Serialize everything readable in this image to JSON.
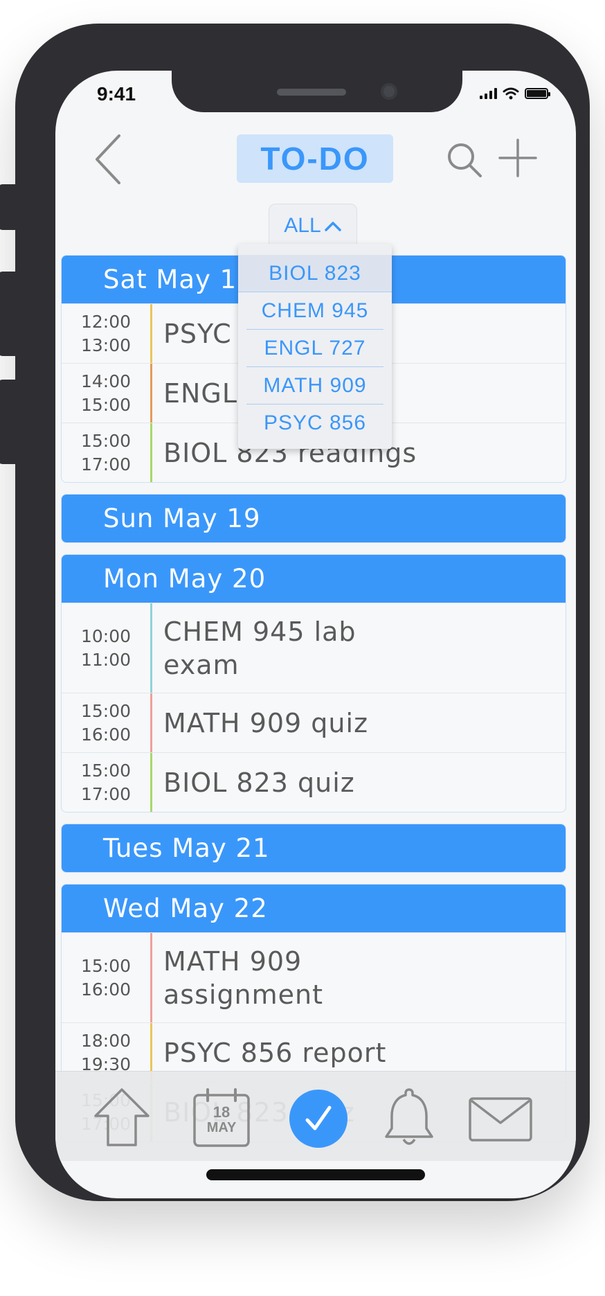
{
  "status_bar": {
    "time": "9:41"
  },
  "header": {
    "title": "TO-DO"
  },
  "filter": {
    "label": "ALL"
  },
  "dropdown_options": [
    "BIOL 823",
    "CHEM 945",
    "ENGL 727",
    "MATH 909",
    "PSYC 856"
  ],
  "days": [
    {
      "label": "Sat May 18",
      "tasks": [
        {
          "start": "12:00",
          "end": "13:00",
          "title": "PSYC 856 quiz",
          "color": "#e9c65a"
        },
        {
          "start": "14:00",
          "end": "15:00",
          "title": "ENGL 727 essay",
          "color": "#e49a5c"
        },
        {
          "start": "15:00",
          "end": "17:00",
          "title": "BIOL 823 readings",
          "color": "#a7d86c"
        }
      ]
    },
    {
      "label": "Sun May 19",
      "tasks": []
    },
    {
      "label": "Mon May 20",
      "tasks": [
        {
          "start": "10:00",
          "end": "11:00",
          "title": "CHEM 945 lab exam",
          "color": "#8fd3d8"
        },
        {
          "start": "15:00",
          "end": "16:00",
          "title": "MATH 909 quiz",
          "color": "#ef9f9a"
        },
        {
          "start": "15:00",
          "end": "17:00",
          "title": "BIOL 823 quiz",
          "color": "#a7d86c"
        }
      ]
    },
    {
      "label": "Tues May 21",
      "tasks": []
    },
    {
      "label": "Wed May 22",
      "tasks": [
        {
          "start": "15:00",
          "end": "16:00",
          "title": "MATH 909 assignment",
          "color": "#ef9f9a"
        },
        {
          "start": "18:00",
          "end": "19:30",
          "title": "PSYC 856 report",
          "color": "#e9c65a"
        },
        {
          "start": "15:00",
          "end": "17:00",
          "title": "BIOL 823 quiz",
          "color": "#a7d86c"
        }
      ]
    }
  ],
  "tab_bar": {
    "calendar_day": "18",
    "calendar_month": "MAY",
    "icons": [
      "home-icon",
      "calendar-icon",
      "checkmark-icon",
      "bell-icon",
      "mail-icon"
    ]
  },
  "colors": {
    "accent": "#3a97fa",
    "title_bg": "#cfe3fb"
  }
}
